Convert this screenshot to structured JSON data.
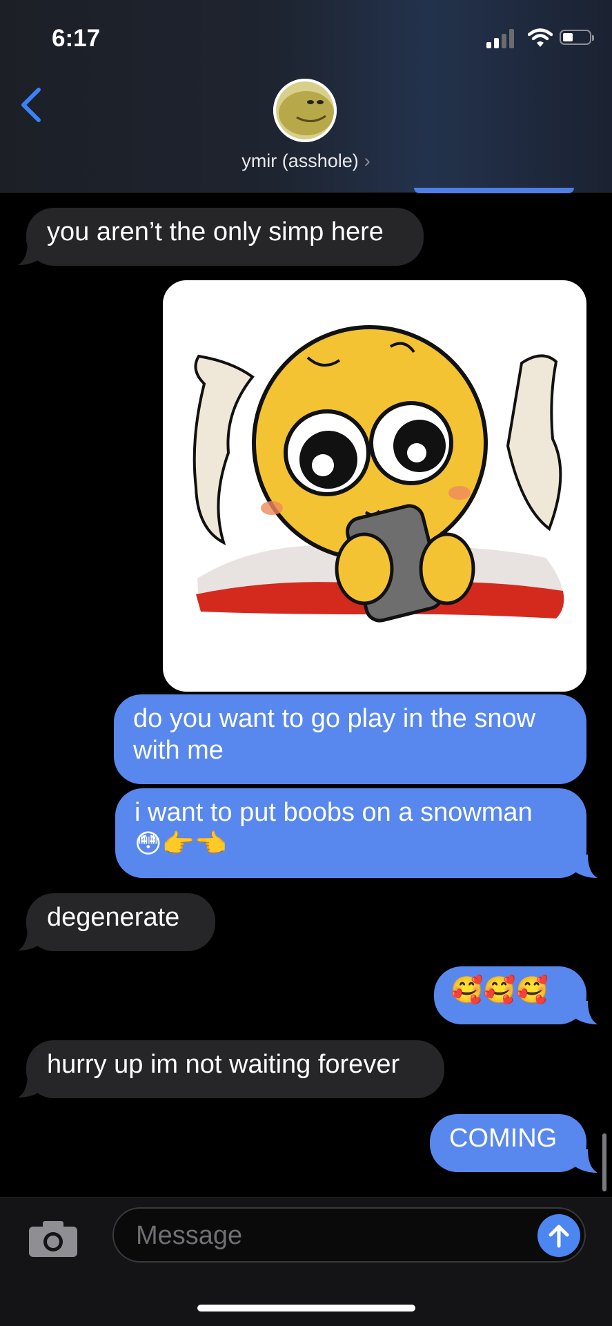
{
  "status_bar": {
    "time": "6:17"
  },
  "header": {
    "back_icon": "chevron-left-icon",
    "contact_name": "ymir (asshole)",
    "contact_chevron": "›"
  },
  "colors": {
    "incoming_bubble": "#262628",
    "outgoing_bubble": "#5888ee",
    "accent": "#4c86f0"
  },
  "messages": [
    {
      "direction": "incoming",
      "type": "text",
      "text": "you aren’t the only simp here"
    },
    {
      "direction": "outgoing",
      "type": "image",
      "description_icon": "sticker-image"
    },
    {
      "direction": "outgoing",
      "type": "text",
      "text": "do you want to go play in the snow with me"
    },
    {
      "direction": "outgoing",
      "type": "text",
      "text": "i want to put boobs on a snowman",
      "text2": "😳👉👈"
    },
    {
      "direction": "incoming",
      "type": "text",
      "text": "degenerate"
    },
    {
      "direction": "outgoing",
      "type": "text",
      "text": "🥰🥰🥰"
    },
    {
      "direction": "incoming",
      "type": "text",
      "text": "hurry up im not waiting forever"
    },
    {
      "direction": "outgoing",
      "type": "text",
      "text": "COMING"
    }
  ],
  "composer": {
    "placeholder": "Message",
    "camera_icon": "camera-icon",
    "send_icon": "arrow-up-icon"
  }
}
